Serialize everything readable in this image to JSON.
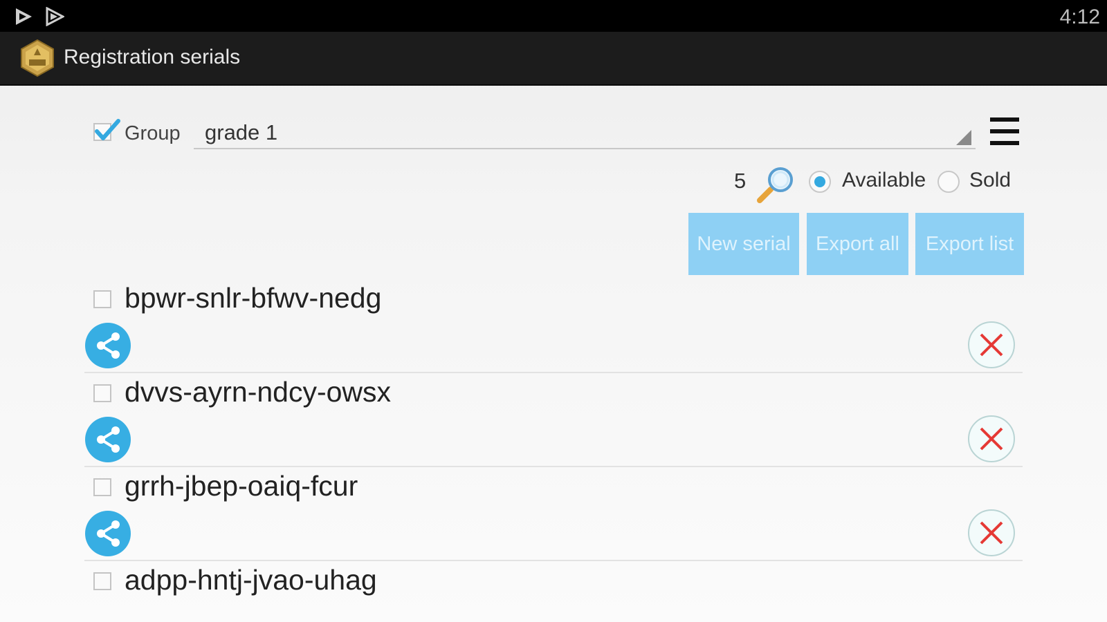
{
  "status_bar": {
    "time": "4:12",
    "icons": [
      "play-store-icon",
      "play-store-outline-icon"
    ]
  },
  "action_bar": {
    "title": "Registration serials",
    "logo_icon": "app-logo-icon"
  },
  "group": {
    "label": "Group",
    "checked": true,
    "selected_value": "grade 1"
  },
  "filter": {
    "count": "5",
    "available_label": "Available",
    "sold_label": "Sold",
    "selected": "Available"
  },
  "buttons": {
    "new_serial": "New serial",
    "export_all": "Export all",
    "export_list": "Export list"
  },
  "serials": [
    {
      "code": "bpwr-snlr-bfwv-nedg",
      "checked": false
    },
    {
      "code": "dvvs-ayrn-ndcy-owsx",
      "checked": false
    },
    {
      "code": "grrh-jbep-oaiq-fcur",
      "checked": false
    },
    {
      "code": "adpp-hntj-jvao-uhag",
      "checked": false
    }
  ],
  "colors": {
    "accent": "#34a9e0",
    "button_bg": "#8ed0f4",
    "delete_red": "#e53935"
  }
}
